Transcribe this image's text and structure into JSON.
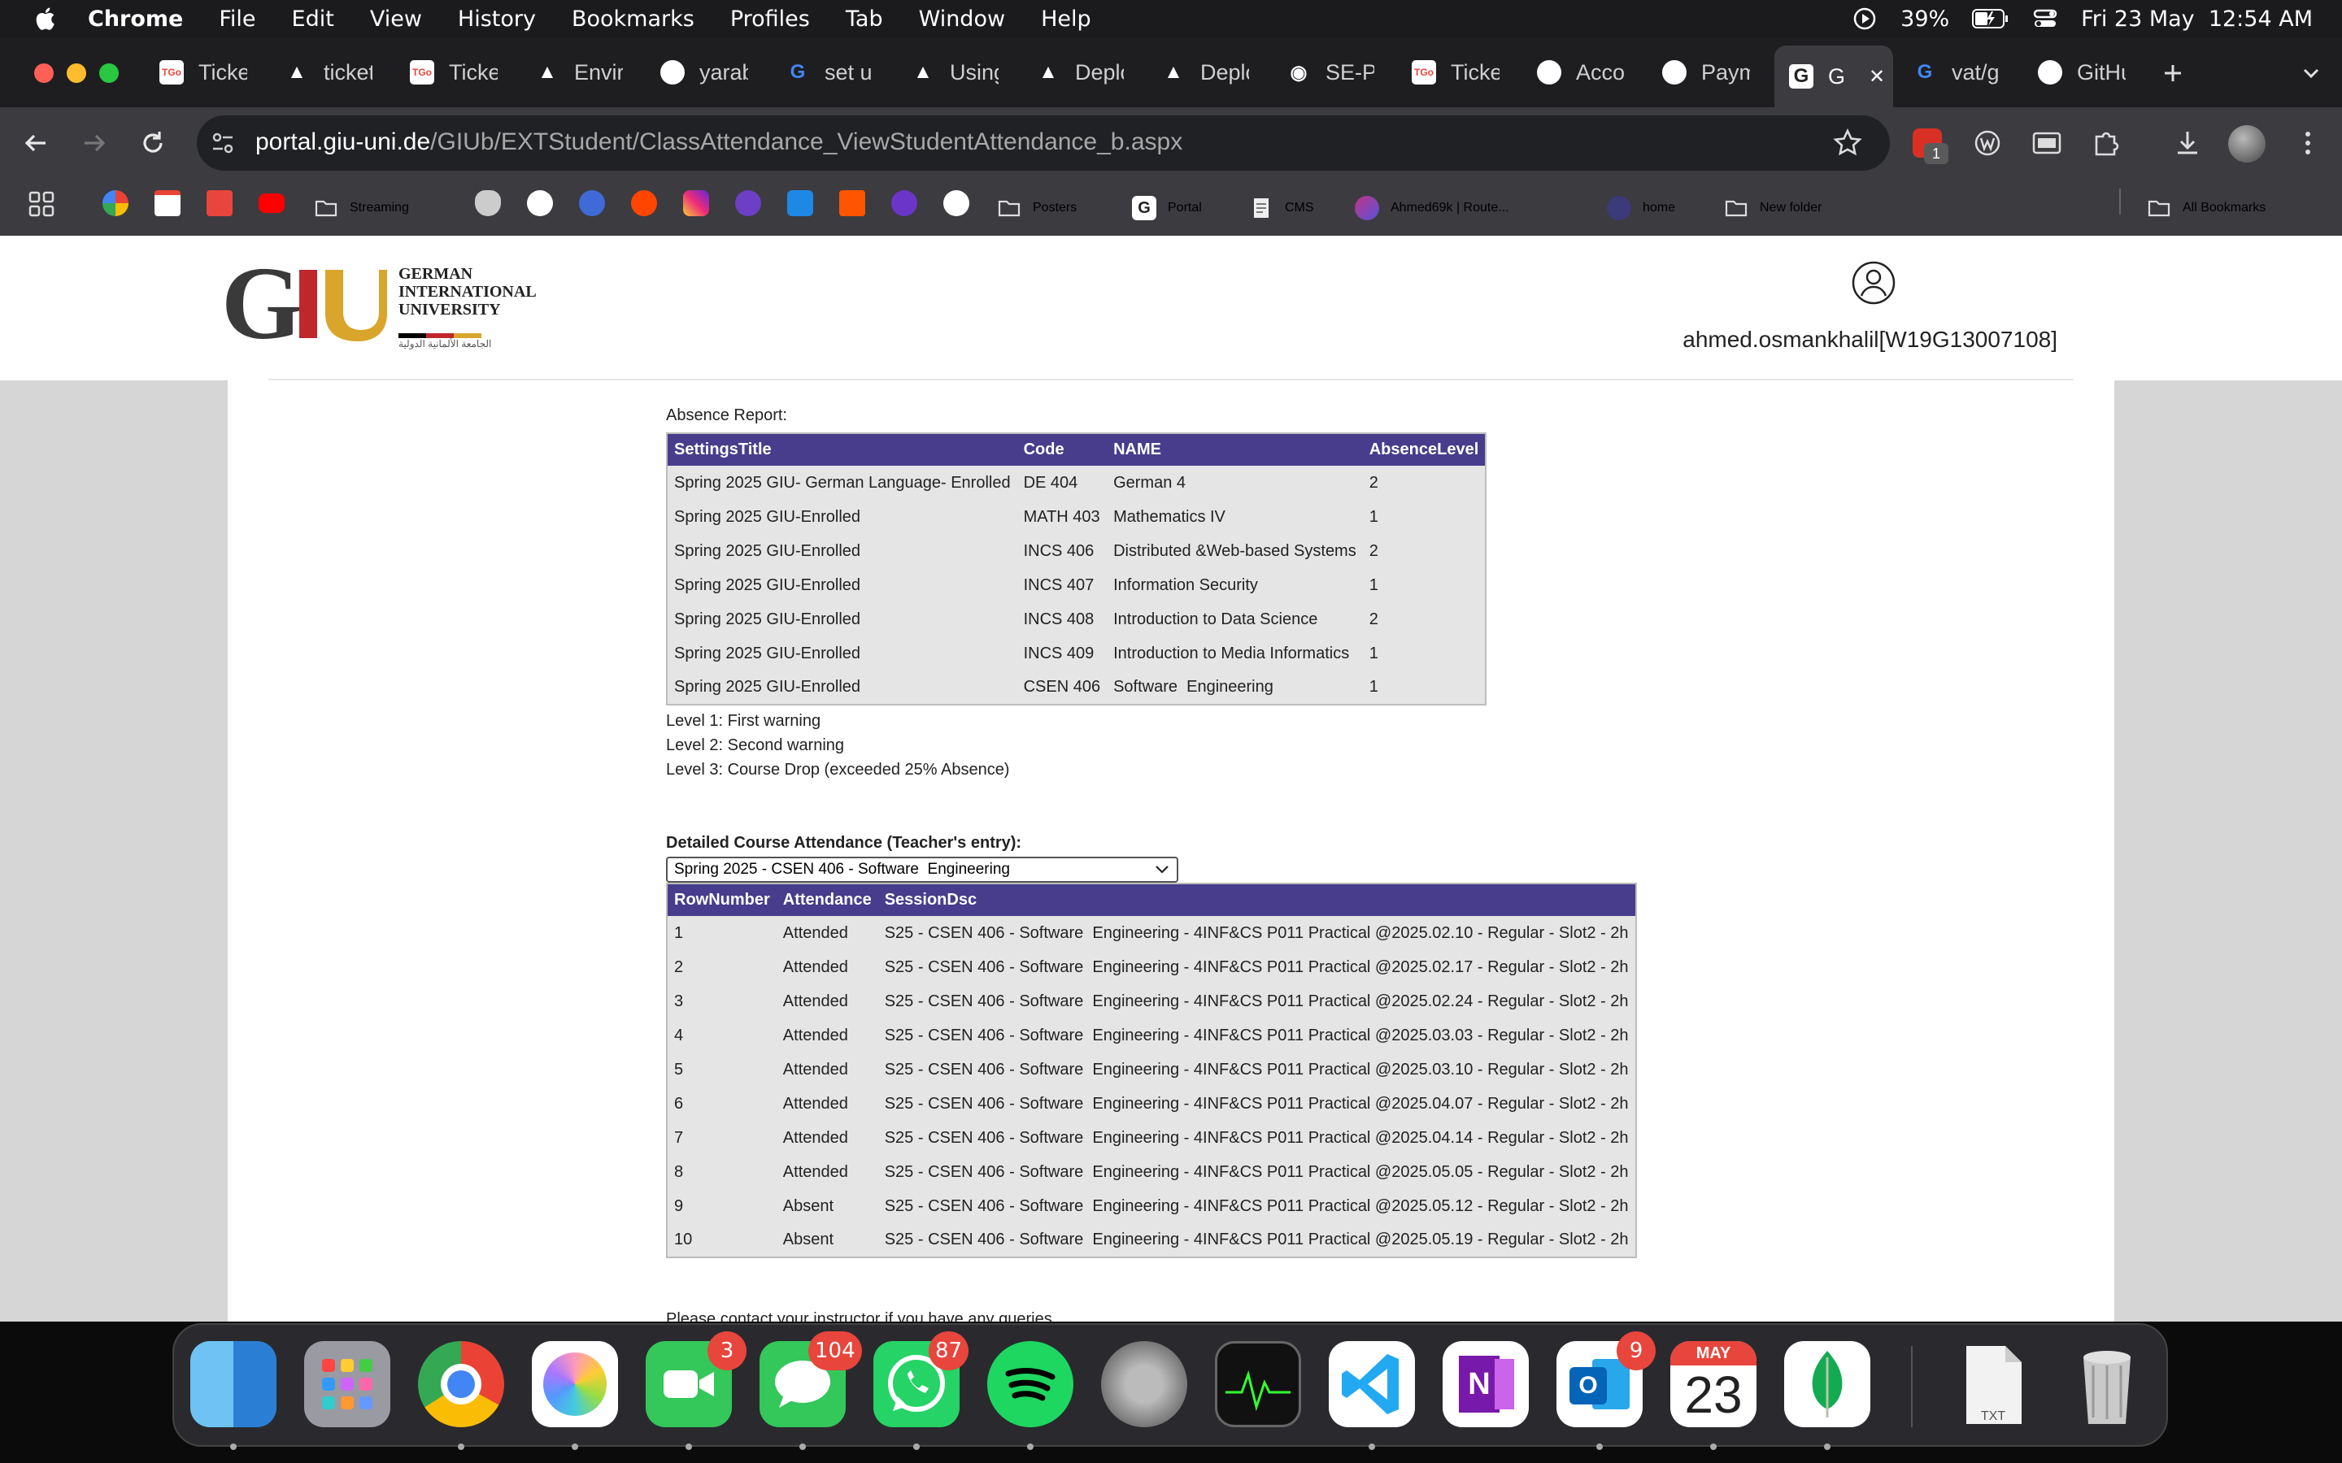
{
  "menubar": {
    "app": "Chrome",
    "menus": [
      "File",
      "Edit",
      "View",
      "History",
      "Bookmarks",
      "Profiles",
      "Tab",
      "Window",
      "Help"
    ],
    "battery": "39%",
    "datetime": "Fri 23 May  12:54 AM"
  },
  "tabs": [
    {
      "label": "Ticke",
      "fav": "TGo",
      "color": "#e8453c"
    },
    {
      "label": "ticket",
      "fav": "▲",
      "color": "#ffffff"
    },
    {
      "label": "Ticke",
      "fav": "TGo",
      "color": "#e8453c"
    },
    {
      "label": "Envir",
      "fav": "▲",
      "color": "#ffffff"
    },
    {
      "label": "yarab",
      "fav": "github",
      "color": "#ffffff"
    },
    {
      "label": "set u",
      "fav": "G",
      "color": "#4285f4"
    },
    {
      "label": "Using",
      "fav": "▲",
      "color": "#ffffff"
    },
    {
      "label": "Deplo",
      "fav": "▲",
      "color": "#ffffff"
    },
    {
      "label": "Deplo",
      "fav": "▲",
      "color": "#ffffff"
    },
    {
      "label": "SE-P",
      "fav": "◉",
      "color": "#ffffff"
    },
    {
      "label": "Ticke",
      "fav": "TGo",
      "color": "#e8453c"
    },
    {
      "label": "Acco",
      "fav": "github",
      "color": "#ffffff"
    },
    {
      "label": "Paym",
      "fav": "github",
      "color": "#ffffff"
    },
    {
      "label": "G",
      "fav": "G",
      "color": "#ffffff",
      "active": true
    },
    {
      "label": "vat/g",
      "fav": "G",
      "color": "#4285f4"
    },
    {
      "label": "GitHu",
      "fav": "github",
      "color": "#ffffff"
    }
  ],
  "address": {
    "host": "portal.giu-uni.de",
    "path": "/GIUb/EXTStudent/ClassAttendance_ViewStudentAttendance_b.aspx"
  },
  "bookmarks": {
    "streaming": "Streaming",
    "posters": "Posters",
    "portal": "Portal",
    "cms": "CMS",
    "ahmed": "Ahmed69k | Route...",
    "home": "home",
    "new_folder": "New folder",
    "all": "All Bookmarks"
  },
  "header": {
    "logo_lines": [
      "GERMAN",
      "INTERNATIONAL",
      "UNIVERSITY"
    ],
    "logo_arabic": "الجامعة الألمانية الدولية",
    "username": "ahmed.osmankhalil[W19G13007108]"
  },
  "absence": {
    "label": "Absence Report:",
    "columns": [
      "SettingsTitle",
      "Code",
      "NAME",
      "AbsenceLevel"
    ],
    "rows": [
      [
        "Spring 2025 GIU- German Language- Enrolled",
        "DE 404",
        "German 4",
        "2"
      ],
      [
        "Spring 2025 GIU-Enrolled",
        "MATH 403",
        "Mathematics IV",
        "1"
      ],
      [
        "Spring 2025 GIU-Enrolled",
        "INCS 406",
        "Distributed &Web-based Systems",
        "2"
      ],
      [
        "Spring 2025 GIU-Enrolled",
        "INCS 407",
        "Information Security",
        "1"
      ],
      [
        "Spring 2025 GIU-Enrolled",
        "INCS 408",
        "Introduction to Data Science",
        "2"
      ],
      [
        "Spring 2025 GIU-Enrolled",
        "INCS 409",
        "Introduction to Media Informatics",
        "1"
      ],
      [
        "Spring 2025 GIU-Enrolled",
        "CSEN 406",
        "Software  Engineering",
        "1"
      ]
    ]
  },
  "legend": [
    "Level 1: First warning",
    "Level 2: Second warning",
    "Level 3: Course Drop (exceeded 25% Absence)"
  ],
  "detail": {
    "label": "Detailed Course Attendance (Teacher's entry):",
    "selected_course": "Spring 2025 - CSEN 406 - Software  Engineering",
    "columns": [
      "RowNumber",
      "Attendance",
      "SessionDsc"
    ],
    "rows": [
      [
        "1",
        "Attended",
        "S25 - CSEN 406 - Software  Engineering - 4INF&CS P011 Practical @2025.02.10 - Regular - Slot2 - 2h"
      ],
      [
        "2",
        "Attended",
        "S25 - CSEN 406 - Software  Engineering - 4INF&CS P011 Practical @2025.02.17 - Regular - Slot2 - 2h"
      ],
      [
        "3",
        "Attended",
        "S25 - CSEN 406 - Software  Engineering - 4INF&CS P011 Practical @2025.02.24 - Regular - Slot2 - 2h"
      ],
      [
        "4",
        "Attended",
        "S25 - CSEN 406 - Software  Engineering - 4INF&CS P011 Practical @2025.03.03 - Regular - Slot2 - 2h"
      ],
      [
        "5",
        "Attended",
        "S25 - CSEN 406 - Software  Engineering - 4INF&CS P011 Practical @2025.03.10 - Regular - Slot2 - 2h"
      ],
      [
        "6",
        "Attended",
        "S25 - CSEN 406 - Software  Engineering - 4INF&CS P011 Practical @2025.04.07 - Regular - Slot2 - 2h"
      ],
      [
        "7",
        "Attended",
        "S25 - CSEN 406 - Software  Engineering - 4INF&CS P011 Practical @2025.04.14 - Regular - Slot2 - 2h"
      ],
      [
        "8",
        "Attended",
        "S25 - CSEN 406 - Software  Engineering - 4INF&CS P011 Practical @2025.05.05 - Regular - Slot2 - 2h"
      ],
      [
        "9",
        "Absent",
        "S25 - CSEN 406 - Software  Engineering - 4INF&CS P011 Practical @2025.05.12 - Regular - Slot2 - 2h"
      ],
      [
        "10",
        "Absent",
        "S25 - CSEN 406 - Software  Engineering - 4INF&CS P011 Practical @2025.05.19 - Regular - Slot2 - 2h"
      ]
    ]
  },
  "cutoff_text": "Please contact your instructor if you have any queries",
  "dock": {
    "facetime_badge": "3",
    "messages_badge": "104",
    "whatsapp_badge": "87",
    "outlook_badge": "9",
    "calendar_month": "MAY",
    "calendar_day": "23",
    "txt_label": "TXT"
  },
  "colors": {
    "table_header": "#473d8c",
    "giu_gold": "#d9a52a",
    "giu_red": "#c0272d"
  }
}
